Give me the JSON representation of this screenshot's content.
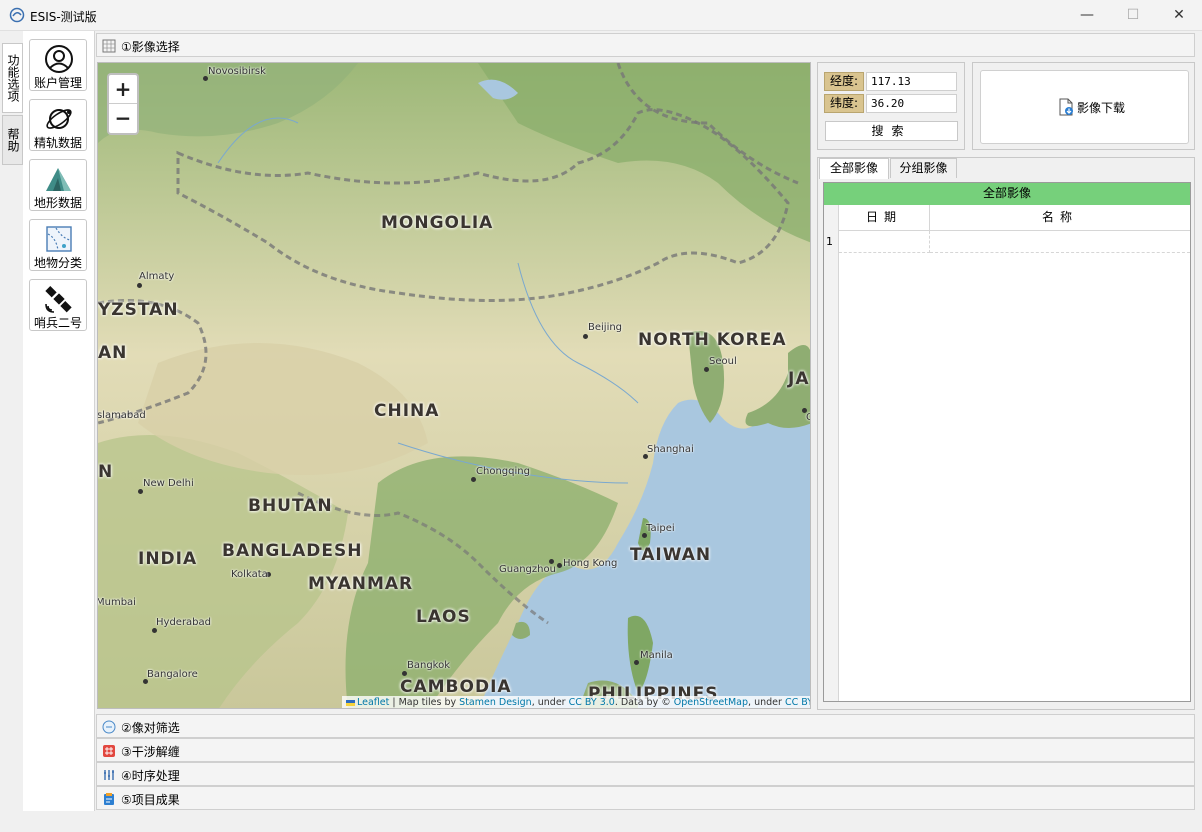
{
  "window": {
    "title": "ESIS-测试版",
    "minimize": "—",
    "maximize": "☐",
    "close": "✕"
  },
  "vertical_tabs": [
    {
      "label": "功能选项"
    },
    {
      "label": "帮助"
    }
  ],
  "tools": [
    {
      "label": "账户管理",
      "icon": "account-icon"
    },
    {
      "label": "精轨数据",
      "icon": "orbit-icon"
    },
    {
      "label": "地形数据",
      "icon": "terrain-icon"
    },
    {
      "label": "地物分类",
      "icon": "classification-icon"
    },
    {
      "label": "哨兵二号",
      "icon": "satellite-icon"
    }
  ],
  "sections": {
    "s1": "①影像选择",
    "s2": "②像对筛选",
    "s3": "③干涉解缠",
    "s4": "④时序处理",
    "s5": "⑤项目成果"
  },
  "map": {
    "zoom_in": "+",
    "zoom_out": "−",
    "countries": [
      {
        "name": "MONGOLIA"
      },
      {
        "name": "CHINA"
      },
      {
        "name": "NORTH KOREA"
      },
      {
        "name": "JA"
      },
      {
        "name": "YZSTAN"
      },
      {
        "name": "AN"
      },
      {
        "name": "N"
      },
      {
        "name": "BHUTAN"
      },
      {
        "name": "INDIA"
      },
      {
        "name": "BANGLADESH"
      },
      {
        "name": "MYANMAR"
      },
      {
        "name": "LAOS"
      },
      {
        "name": "TAIWAN"
      },
      {
        "name": "CAMBODIA"
      },
      {
        "name": "PHILIPPINES"
      }
    ],
    "cities": [
      {
        "name": "Novosibirsk"
      },
      {
        "name": "Almaty"
      },
      {
        "name": "Beijing"
      },
      {
        "name": "Seoul"
      },
      {
        "name": "Islamabad"
      },
      {
        "name": "Shanghai"
      },
      {
        "name": "Chongqing"
      },
      {
        "name": "New Delhi"
      },
      {
        "name": "Taipei"
      },
      {
        "name": "Kolkata"
      },
      {
        "name": "Guangzhou"
      },
      {
        "name": "Hong Kong"
      },
      {
        "name": "Mumbai"
      },
      {
        "name": "Hyderabad"
      },
      {
        "name": "Manila"
      },
      {
        "name": "Bangkok"
      },
      {
        "name": "Bangalore"
      },
      {
        "name": "O"
      }
    ],
    "attribution": {
      "leaflet": "Leaflet",
      "t1": " | Map tiles by ",
      "stamen": "Stamen Design",
      "t2": ", under ",
      "ccby": "CC BY 3.0",
      "t3": ". Data by © ",
      "osm": "OpenStreetMap",
      "t4": ", under ",
      "ccbysa": "CC BY SA",
      "t5": "."
    }
  },
  "coords": {
    "lon_label": "经度:",
    "lon_value": "117.13",
    "lat_label": "纬度:",
    "lat_value": "36.20",
    "search": "搜索"
  },
  "download": {
    "label": "影像下载"
  },
  "tabs": [
    {
      "label": "全部影像",
      "active": true
    },
    {
      "label": "分组影像",
      "active": false
    }
  ],
  "grid": {
    "title": "全部影像",
    "columns": [
      "日期",
      "名称"
    ],
    "rows": [
      {
        "num": "1",
        "date": "",
        "name": ""
      }
    ]
  },
  "colors": {
    "grid_header": "#76d07b",
    "coord_label": "#d9c48f"
  }
}
